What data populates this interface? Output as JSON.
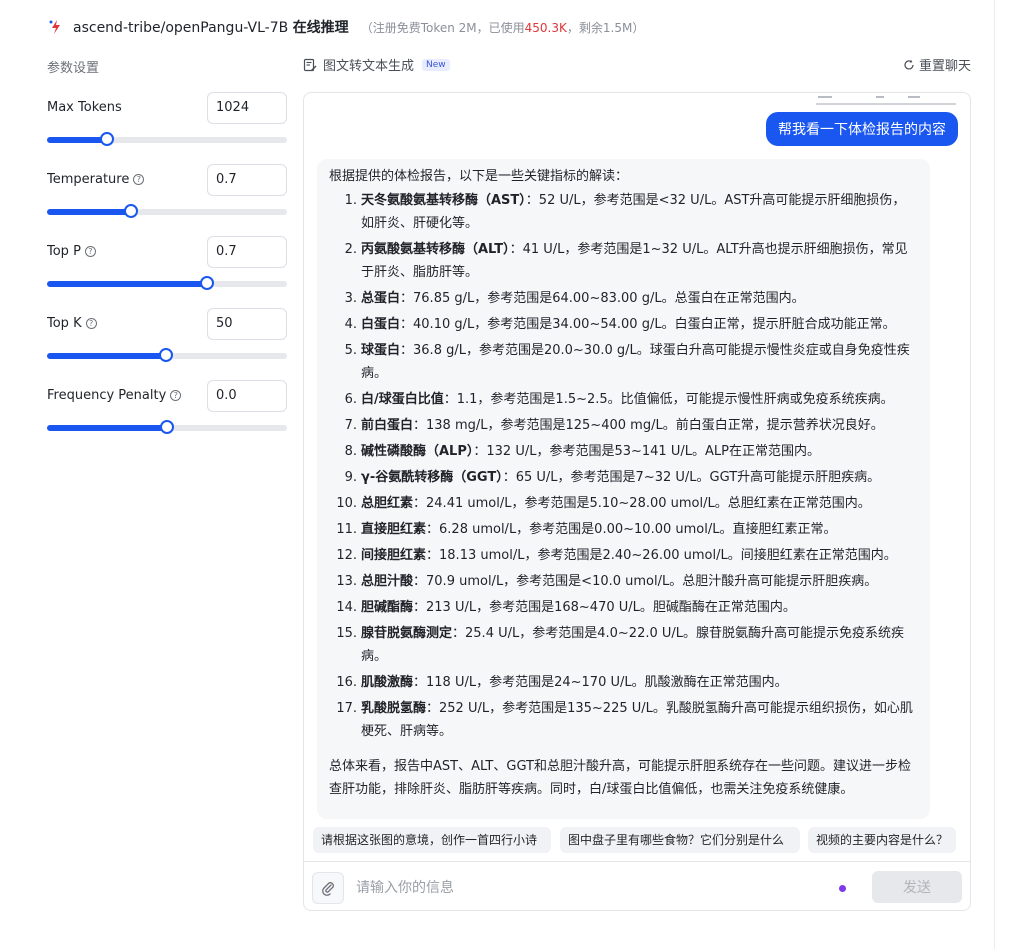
{
  "header": {
    "model_name_prefix": "ascend-tribe/openPangu-VL-7B ",
    "model_name_suffix": "在线推理",
    "quota_prefix": "（注册免费Token 2M，已使用",
    "quota_used": "450.3K",
    "quota_suffix": "，剩余1.5M）"
  },
  "params": {
    "title": "参数设置",
    "items": [
      {
        "label": "Max Tokens",
        "value": "1024",
        "fraction": 0.25,
        "help": false
      },
      {
        "label": "Temperature",
        "value": "0.7",
        "fraction": 0.35,
        "help": true
      },
      {
        "label": "Top P",
        "value": "0.7",
        "fraction": 0.667,
        "help": true
      },
      {
        "label": "Top K",
        "value": "50",
        "fraction": 0.495,
        "help": true
      },
      {
        "label": "Frequency Penalty",
        "value": "0.0",
        "fraction": 0.5,
        "help": true
      }
    ]
  },
  "chat": {
    "tab_label": "图文转文本生成",
    "tab_badge": "New",
    "reset_label": "重置聊天",
    "user_message": "帮我看一下体检报告的内容",
    "reply_intro": "根据提供的体检报告，以下是一些关键指标的解读：",
    "items": [
      {
        "n": "1.",
        "term": "天冬氨酸氨基转移酶（AST）",
        "text": "：52 U/L，参考范围是<32 U/L。AST升高可能提示肝细胞损伤，如肝炎、肝硬化等。"
      },
      {
        "n": "2.",
        "term": "丙氨酸氨基转移酶（ALT）",
        "text": "：41 U/L，参考范围是1~32 U/L。ALT升高也提示肝细胞损伤，常见于肝炎、脂肪肝等。"
      },
      {
        "n": "3.",
        "term": "总蛋白",
        "text": "：76.85 g/L，参考范围是64.00~83.00 g/L。总蛋白在正常范围内。"
      },
      {
        "n": "4.",
        "term": "白蛋白",
        "text": "：40.10 g/L，参考范围是34.00~54.00 g/L。白蛋白正常，提示肝脏合成功能正常。"
      },
      {
        "n": "5.",
        "term": "球蛋白",
        "text": "：36.8 g/L，参考范围是20.0~30.0 g/L。球蛋白升高可能提示慢性炎症或自身免疫性疾病。"
      },
      {
        "n": "6.",
        "term": "白/球蛋白比值",
        "text": "：1.1，参考范围是1.5~2.5。比值偏低，可能提示慢性肝病或免疫系统疾病。"
      },
      {
        "n": "7.",
        "term": "前白蛋白",
        "text": "：138 mg/L，参考范围是125~400 mg/L。前白蛋白正常，提示营养状况良好。"
      },
      {
        "n": "8.",
        "term": "碱性磷酸酶（ALP）",
        "text": "：132 U/L，参考范围是53~141 U/L。ALP在正常范围内。"
      },
      {
        "n": "9.",
        "term": "γ-谷氨酰转移酶（GGT）",
        "text": "：65 U/L，参考范围是7~32 U/L。GGT升高可能提示肝胆疾病。"
      },
      {
        "n": "10.",
        "term": "总胆红素",
        "text": "：24.41 umol/L，参考范围是5.10~28.00 umol/L。总胆红素在正常范围内。"
      },
      {
        "n": "11.",
        "term": "直接胆红素",
        "text": "：6.28 umol/L，参考范围是0.00~10.00 umol/L。直接胆红素正常。"
      },
      {
        "n": "12.",
        "term": "间接胆红素",
        "text": "：18.13 umol/L，参考范围是2.40~26.00 umol/L。间接胆红素在正常范围内。"
      },
      {
        "n": "13.",
        "term": "总胆汁酸",
        "text": "：70.9 umol/L，参考范围是<10.0 umol/L。总胆汁酸升高可能提示肝胆疾病。"
      },
      {
        "n": "14.",
        "term": "胆碱酯酶",
        "text": "：213 U/L，参考范围是168~470 U/L。胆碱酯酶在正常范围内。"
      },
      {
        "n": "15.",
        "term": "腺苷脱氨酶测定",
        "text": "：25.4 U/L，参考范围是4.0~22.0 U/L。腺苷脱氨酶升高可能提示免疫系统疾病。"
      },
      {
        "n": "16.",
        "term": "肌酸激酶",
        "text": "：118 U/L，参考范围是24~170 U/L。肌酸激酶在正常范围内。"
      },
      {
        "n": "17.",
        "term": "乳酸脱氢酶",
        "text": "：252 U/L，参考范围是135~225 U/L。乳酸脱氢酶升高可能提示组织损伤，如心肌梗死、肝病等。"
      }
    ],
    "reply_summary": "总体来看，报告中AST、ALT、GGT和总胆汁酸升高，可能提示肝胆系统存在一些问题。建议进一步检查肝功能，排除肝炎、脂肪肝等疾病。同时，白/球蛋白比值偏低，也需关注免疫系统健康。",
    "suggestions": [
      "请根据这张图的意境，创作一首四行小诗",
      "图中盘子里有哪些食物？它们分别是什么",
      "视频的主要内容是什么？"
    ],
    "input_placeholder": "请输入你的信息",
    "send_label": "发送"
  },
  "colors": {
    "accent": "#1a56f0",
    "quota_used": "#e0363b",
    "status_dot": "#7c3aed"
  },
  "icons": [
    "logo-icon",
    "help-icon",
    "edit-doc-icon",
    "refresh-icon",
    "paperclip-icon"
  ]
}
